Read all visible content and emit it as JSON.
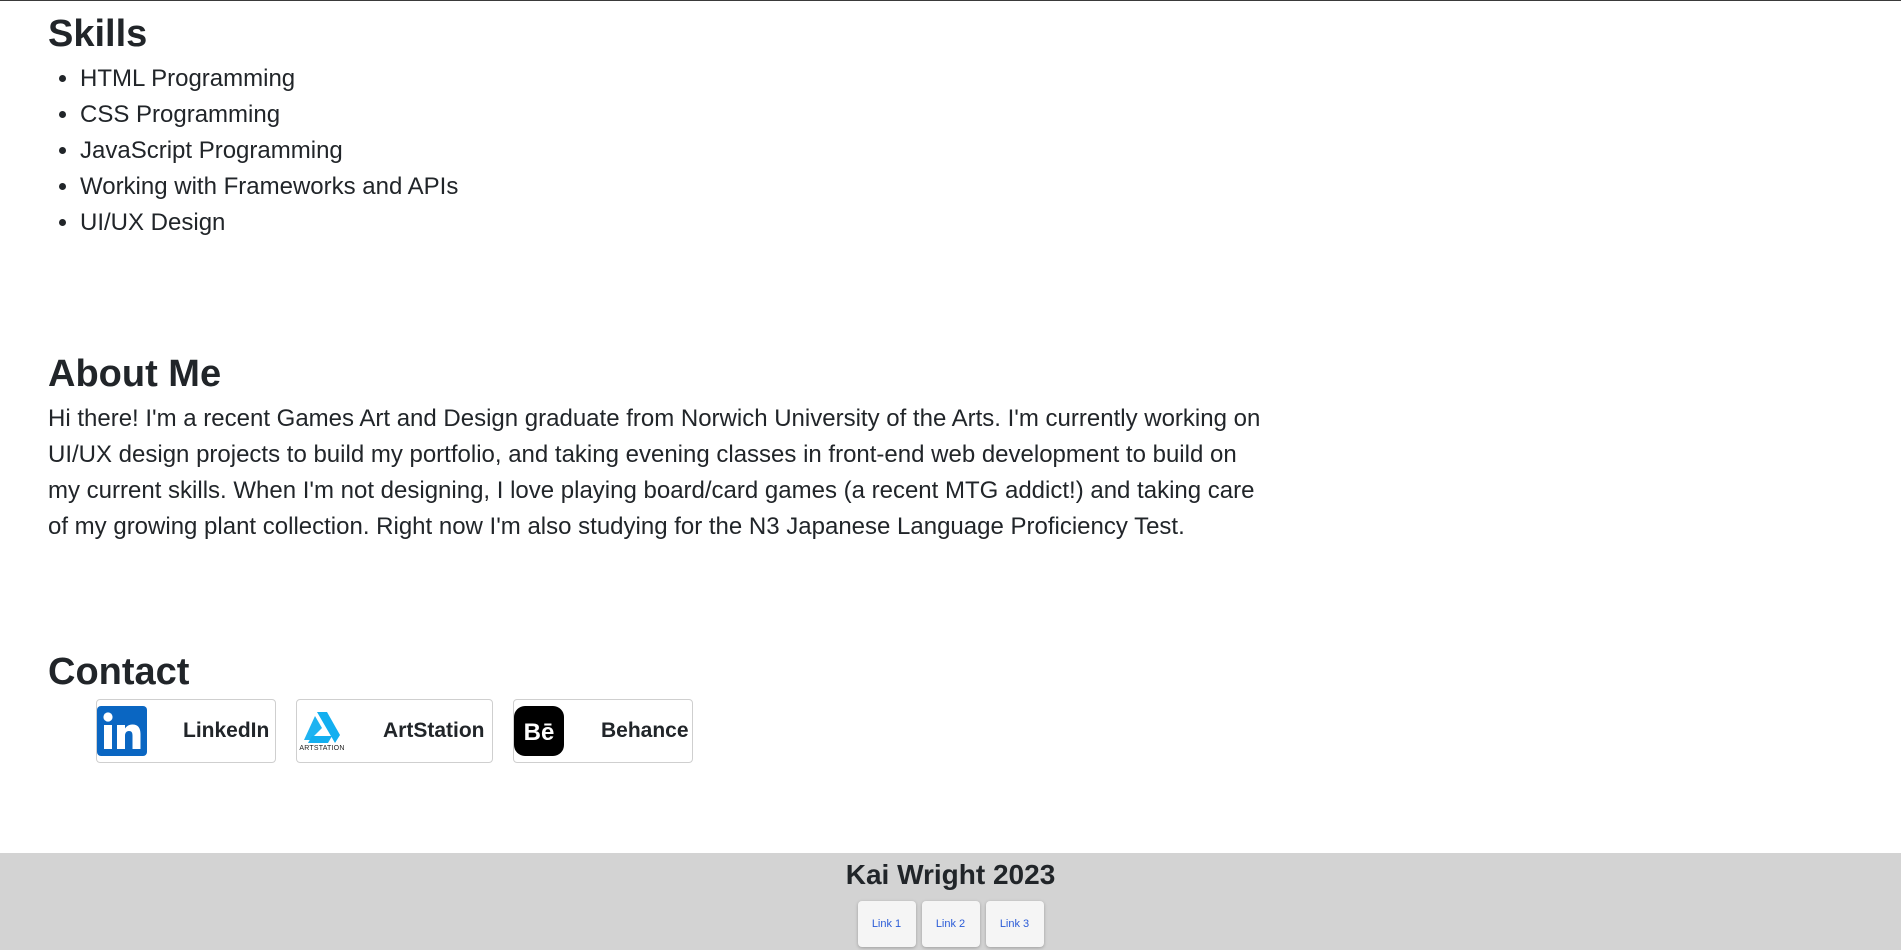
{
  "skills": {
    "heading": "Skills",
    "items": [
      "HTML Programming",
      "CSS Programming",
      "JavaScript Programming",
      "Working with Frameworks and APIs",
      "UI/UX Design"
    ]
  },
  "about": {
    "heading": "About Me",
    "text": "Hi there! I'm a recent Games Art and Design graduate from Norwich University of the Arts. I'm currently working on UI/UX design projects to build my portfolio, and taking evening classes in front-end web development to build on my current skills. When I'm not designing, I love playing board/card games (a recent MTG addict!) and taking care of my growing plant collection. Right now I'm also studying for the N3 Japanese Language Proficiency Test."
  },
  "contact": {
    "heading": "Contact",
    "links": [
      {
        "label": "LinkedIn",
        "icon": "linkedin-icon",
        "color": "#0a66c2"
      },
      {
        "label": "ArtStation",
        "icon": "artstation-icon",
        "color": "#13aff0",
        "logo_text": "ARTSTATION"
      },
      {
        "label": "Behance",
        "icon": "behance-icon",
        "color": "#000000"
      }
    ]
  },
  "footer": {
    "title": "Kai Wright 2023",
    "links": [
      "Link 1",
      "Link 2",
      "Link 3"
    ],
    "background": "#d3d3d3",
    "link_color": "#2a5bd7"
  }
}
